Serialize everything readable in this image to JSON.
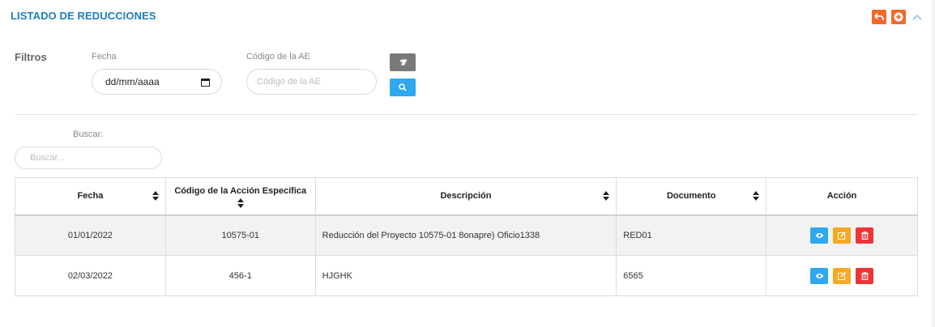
{
  "panel": {
    "title": "LISTADO DE REDUCCIONES",
    "buttons": [
      {
        "name": "back",
        "icon": "undo-icon"
      },
      {
        "name": "add",
        "icon": "plus-circle-icon"
      },
      {
        "name": "collapse",
        "icon": "chevron-up-icon"
      }
    ]
  },
  "filters": {
    "heading": "Filtros",
    "date_label": "Fecha",
    "date_value": "dd/mm/aaaa",
    "code_label": "Código de la AE",
    "code_placeholder": "Código de la AE"
  },
  "search": {
    "label": "Buscar:",
    "placeholder": "Buscar..."
  },
  "table": {
    "headers": [
      "Fecha",
      "Código de la Acción Específica",
      "Descripción",
      "Documento",
      "Acción"
    ],
    "rows": [
      {
        "fecha": "01/01/2022",
        "codigo": "10575-01",
        "descripcion": "Reducción del Proyecto 10575-01 8onapre) Oficio1338",
        "documento": "RED01"
      },
      {
        "fecha": "02/03/2022",
        "codigo": "456-1",
        "descripcion": "HJGHK",
        "documento": "6565"
      }
    ],
    "actions": [
      {
        "name": "view",
        "icon": "eye-icon",
        "color": "#2ea8ee"
      },
      {
        "name": "edit",
        "icon": "edit-icon",
        "color": "#f7a823"
      },
      {
        "name": "delete",
        "icon": "trash-icon",
        "color": "#ee3437"
      }
    ]
  },
  "colors": {
    "title": "#1e7cc0",
    "header_buttons": "#ef6a2a",
    "search_button": "#2ea8ee",
    "erase_button": "#7a7a7a"
  }
}
